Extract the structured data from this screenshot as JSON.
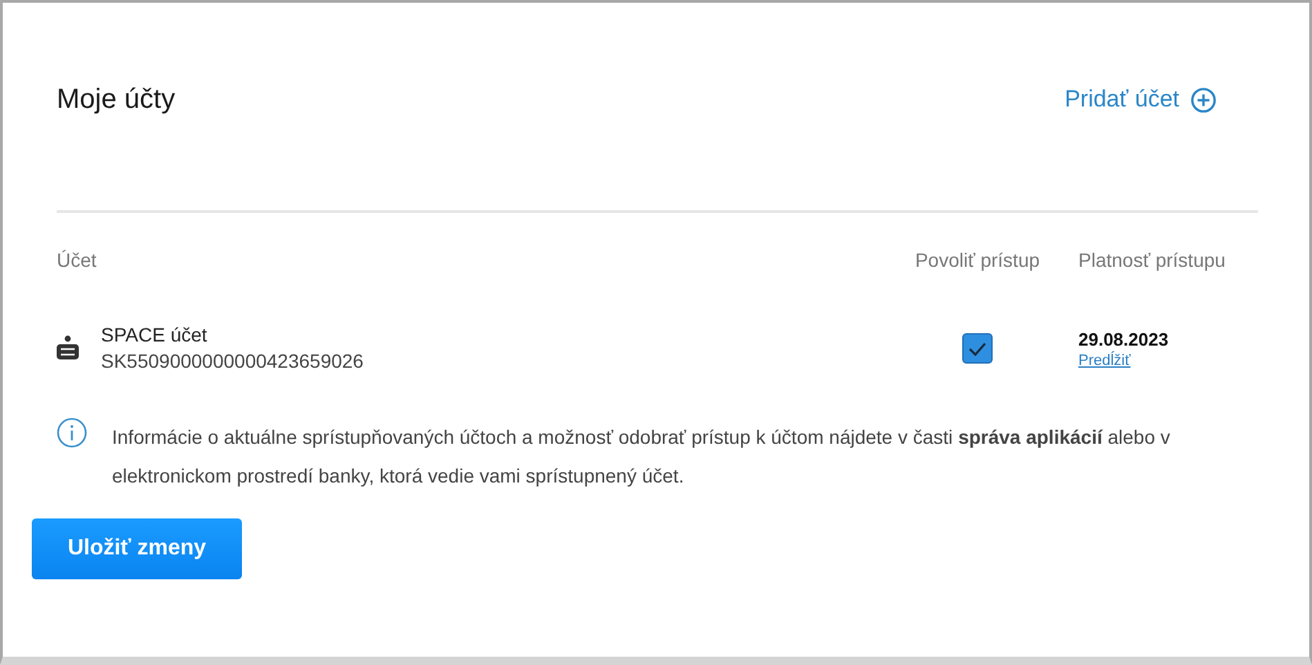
{
  "title": "Moje účty",
  "add_account": "Pridať účet",
  "columns": [
    "Účet",
    "Povoliť prístup",
    "Platnosť prístupu"
  ],
  "accounts": [
    {
      "name": "SPACE účet",
      "iban": "SK5509000000000423659026",
      "checked": true,
      "valid_until": "29.08.2023",
      "extend_link": "Predĺžiť"
    }
  ],
  "info": "Informácie o aktuálne sprístupňovaných účtoch a možnosť odobrať prístup k účtom nájdete v časti **správa aplikácií** alebo v elektronickom prostredí banky, ktorá vedie vami sprístupnený účet.",
  "save_button": "Uložiť zmeny"
}
